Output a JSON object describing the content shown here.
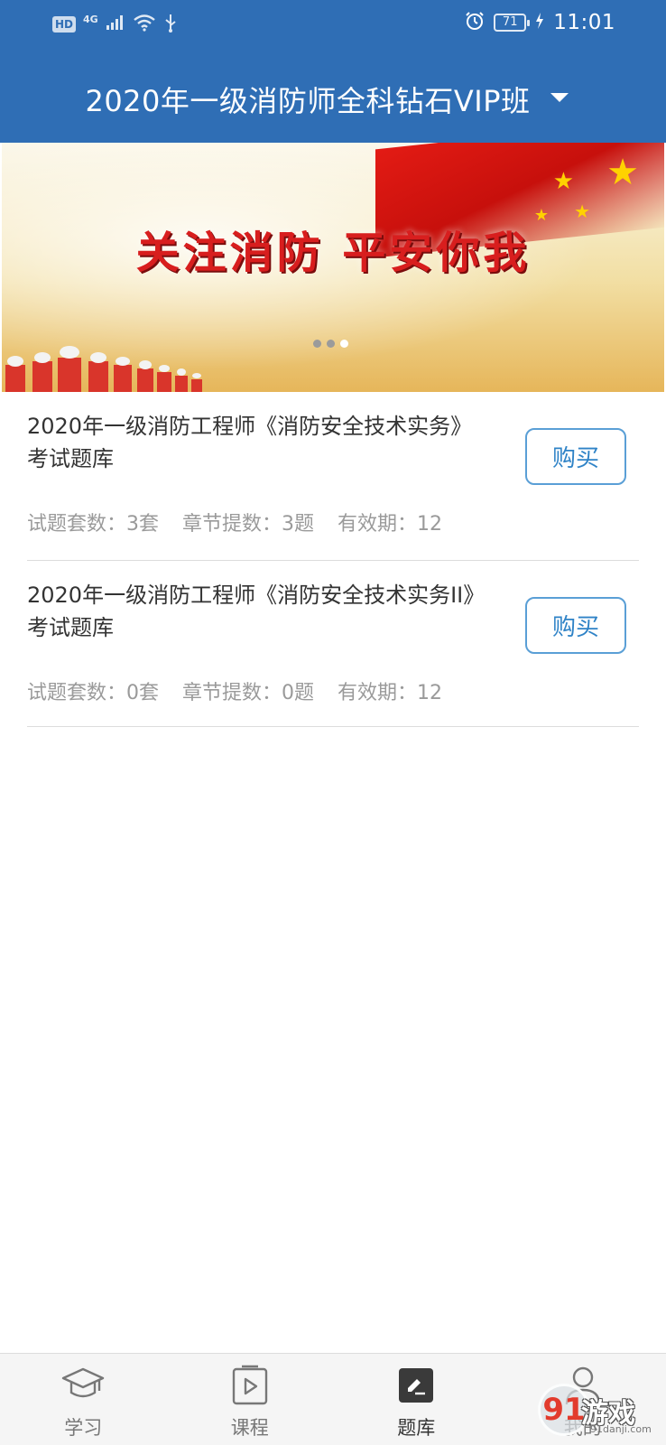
{
  "status_bar": {
    "network_badge": "HD",
    "network_type": "4G",
    "battery_level": "71",
    "time": "11:01"
  },
  "header": {
    "title": "2020年一级消防师全科钻石VIP班"
  },
  "banner": {
    "slogan": "关注消防  平安你我",
    "slide_count": 3,
    "active_slide": 3
  },
  "products": [
    {
      "title": "2020年一级消防工程师《消防安全技术实务》考试题库",
      "buy_label": "购买",
      "sets": "试题套数：3套",
      "chapters": "章节提数：3题",
      "validity": "有效期：12"
    },
    {
      "title": "2020年一级消防工程师《消防安全技术实务II》考试题库",
      "buy_label": "购买",
      "sets": "试题套数：0套",
      "chapters": "章节提数：0题",
      "validity": "有效期：12"
    }
  ],
  "tabbar": {
    "tabs": [
      {
        "label": "学习",
        "icon": "graduation-cap-icon"
      },
      {
        "label": "课程",
        "icon": "play-document-icon"
      },
      {
        "label": "题库",
        "icon": "question-bank-icon"
      },
      {
        "label": "我的",
        "icon": "person-icon"
      }
    ],
    "active_index": 2
  },
  "watermark": {
    "logo_text": "91",
    "brand": "游戏",
    "domain": "91danji.com"
  },
  "colors": {
    "header_bg": "#2f6eb5",
    "button_border": "#5a9fd6",
    "button_text": "#2f83c7",
    "meta_text": "#9a9a9a"
  }
}
